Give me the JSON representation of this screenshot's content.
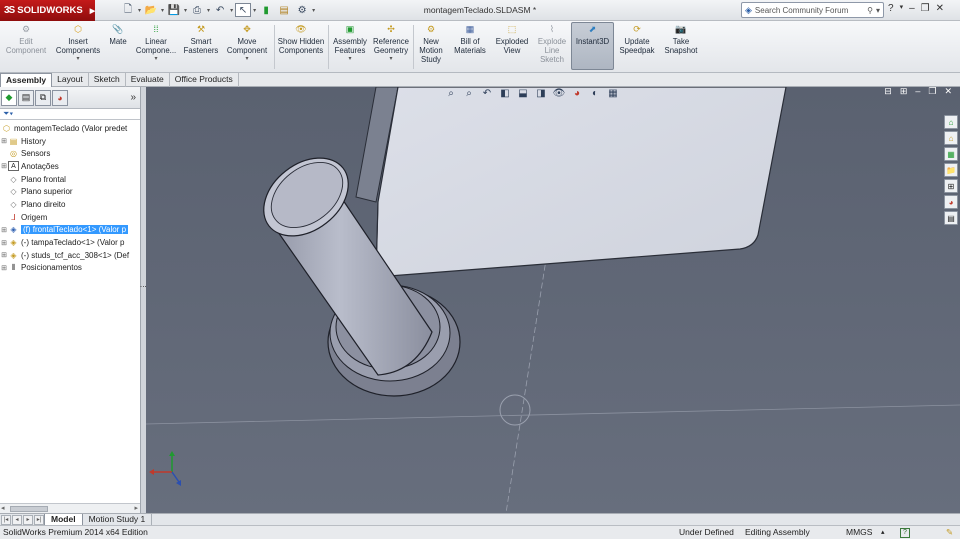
{
  "app": {
    "brand": "SOLIDWORKS",
    "document_title": "montagemTeclado.SLDASM *"
  },
  "search": {
    "placeholder": "Search Community Forum"
  },
  "toolbar": {
    "items": [
      {
        "label": "Edit Component",
        "icon": "edit-component-icon",
        "disabled": true
      },
      {
        "label": "Insert Components",
        "icon": "insert-components-icon"
      },
      {
        "label": "Mate",
        "icon": "mate-icon"
      },
      {
        "label": "Linear Compone...",
        "icon": "linear-pattern-icon"
      },
      {
        "label": "Smart Fasteners",
        "icon": "smart-fasteners-icon"
      },
      {
        "label": "Move Component",
        "icon": "move-component-icon"
      },
      {
        "label": "Show Hidden Components",
        "icon": "show-hidden-icon"
      },
      {
        "label": "Assembly Features",
        "icon": "assembly-features-icon"
      },
      {
        "label": "Reference Geometry",
        "icon": "reference-geometry-icon"
      },
      {
        "label": "New Motion Study",
        "icon": "motion-study-icon"
      },
      {
        "label": "Bill of Materials",
        "icon": "bom-icon"
      },
      {
        "label": "Exploded View",
        "icon": "exploded-view-icon"
      },
      {
        "label": "Explode Line Sketch",
        "icon": "explode-line-icon",
        "disabled": true
      },
      {
        "label": "Instant3D",
        "icon": "instant3d-icon",
        "active": true
      },
      {
        "label": "Update Speedpak",
        "icon": "speedpak-icon"
      },
      {
        "label": "Take Snapshot",
        "icon": "snapshot-icon"
      }
    ]
  },
  "tabs": [
    "Assembly",
    "Layout",
    "Sketch",
    "Evaluate",
    "Office Products"
  ],
  "feature_tree": {
    "root": "montagemTeclado  (Valor predet",
    "nodes": [
      {
        "label": "History",
        "icon": "history-icon",
        "expandable": true
      },
      {
        "label": "Sensors",
        "icon": "sensors-icon",
        "expandable": false
      },
      {
        "label": "Anotações",
        "icon": "annotations-icon",
        "expandable": true
      },
      {
        "label": "Plano frontal",
        "icon": "plane-icon",
        "expandable": false
      },
      {
        "label": "Plano superior",
        "icon": "plane-icon",
        "expandable": false
      },
      {
        "label": "Plano direito",
        "icon": "plane-icon",
        "expandable": false
      },
      {
        "label": "Origem",
        "icon": "origin-icon",
        "expandable": false
      },
      {
        "label": "(f) frontalTeclado<1> (Valor p",
        "icon": "part-icon",
        "expandable": true,
        "selected": true
      },
      {
        "label": "(-) tampaTeclado<1> (Valor p",
        "icon": "part-icon",
        "expandable": true
      },
      {
        "label": "(-) studs_tcf_acc_308<1> (Def",
        "icon": "part-icon",
        "expandable": true
      },
      {
        "label": "Posicionamentos",
        "icon": "mates-icon",
        "expandable": true
      }
    ]
  },
  "bottom_tabs": [
    "Model",
    "Motion Study 1"
  ],
  "status": {
    "edition": "SolidWorks Premium 2014 x64 Edition",
    "definition": "Under Defined",
    "mode": "Editing Assembly",
    "units": "MMGS",
    "help": "?"
  },
  "colors": {
    "brand_red": "#b51515",
    "viewport_bg": "#5f6675",
    "selection": "#3399ff",
    "part_face": "#d4d8e2",
    "pin": "#a9adbc"
  }
}
